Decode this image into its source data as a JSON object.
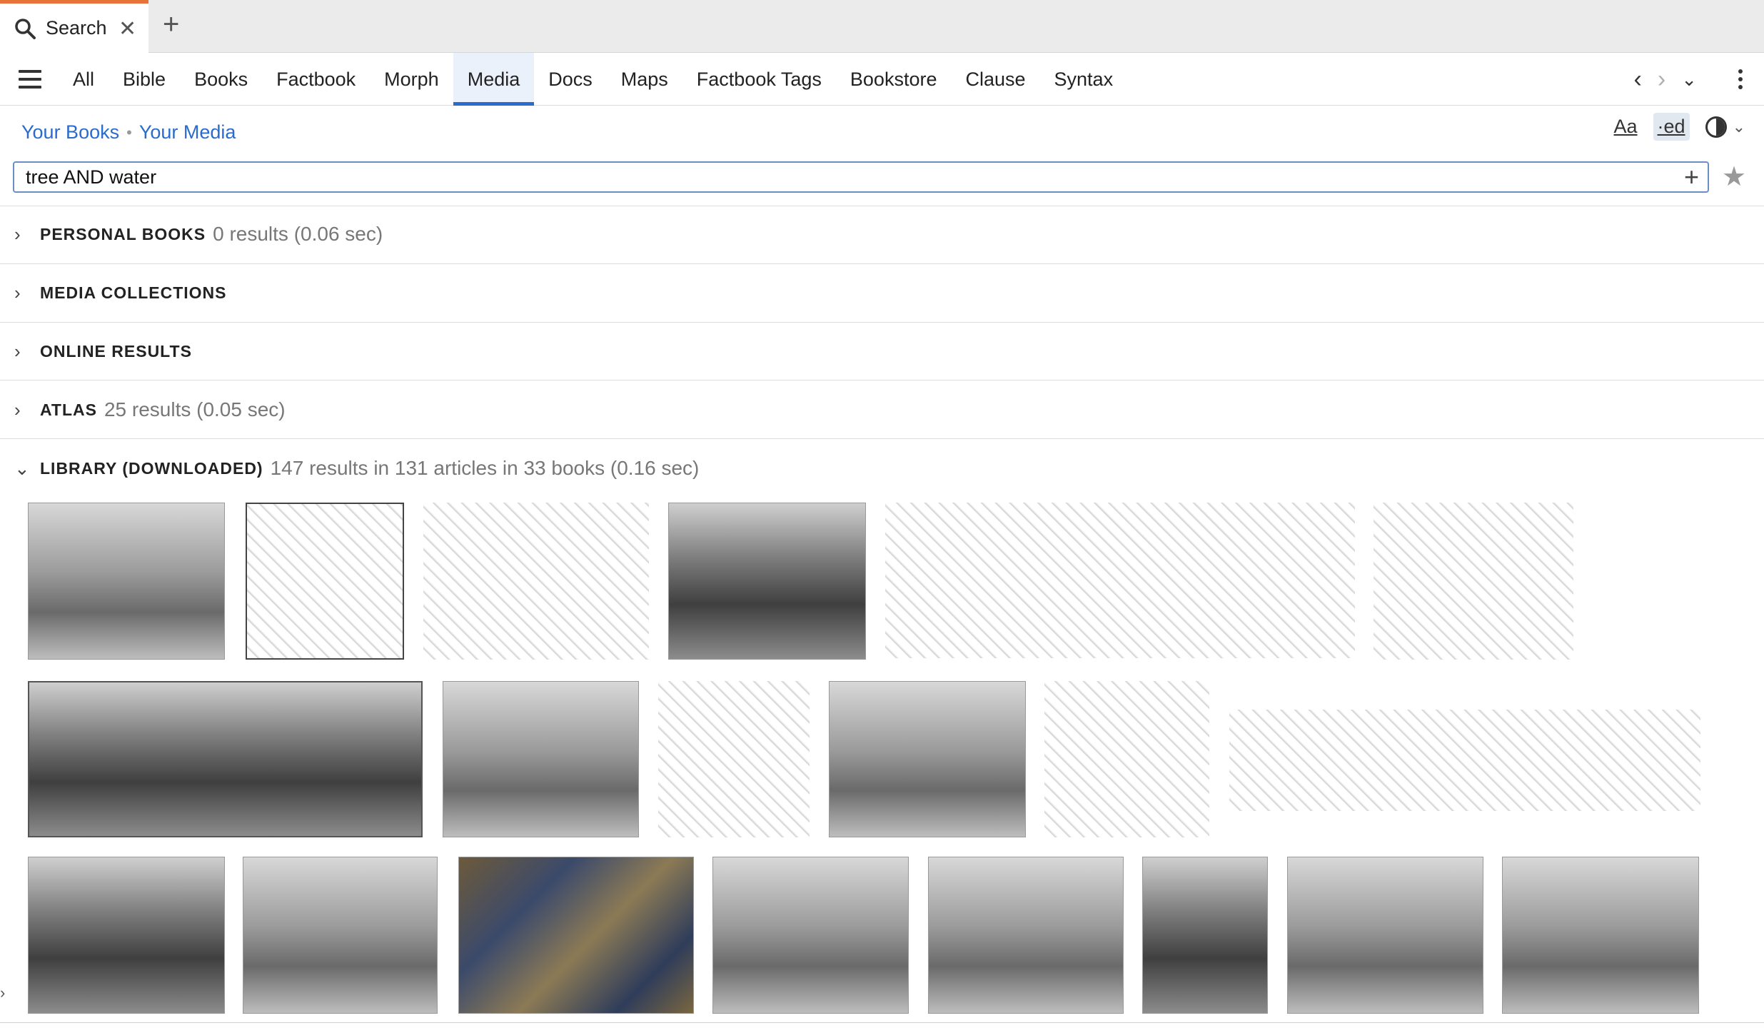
{
  "tab": {
    "label": "Search",
    "close": "✕",
    "new_tab": "+"
  },
  "nav": {
    "tabs": [
      "All",
      "Bible",
      "Books",
      "Factbook",
      "Morph",
      "Media",
      "Docs",
      "Maps",
      "Factbook Tags",
      "Bookstore",
      "Clause",
      "Syntax"
    ],
    "active": "Media",
    "back": "‹",
    "forward": "›",
    "history": "⌄"
  },
  "breadcrumb": {
    "first": "Your Books",
    "separator": "•",
    "second": "Your Media"
  },
  "tools": {
    "font": "Aa",
    "edition": "·ed"
  },
  "search": {
    "value": "tree AND water",
    "add": "+",
    "star": "★"
  },
  "sections": [
    {
      "title": "PERSONAL BOOKS",
      "meta": "0 results (0.06 sec)",
      "expanded": false
    },
    {
      "title": "MEDIA COLLECTIONS",
      "meta": "",
      "expanded": false
    },
    {
      "title": "ONLINE RESULTS",
      "meta": "",
      "expanded": false
    },
    {
      "title": "ATLAS",
      "meta": "25 results (0.05 sec)",
      "expanded": false
    },
    {
      "title": "LIBRARY (DOWNLOADED)",
      "meta": "147 results in 131 articles in 33 books (0.16 sec)",
      "expanded": true
    }
  ],
  "chevrons": {
    "collapsed": "›",
    "expanded": "⌄"
  },
  "colors": {
    "accent": "#2a6ccd",
    "tab_indicator": "#e8733a"
  },
  "media_thumbnail_count": 22
}
